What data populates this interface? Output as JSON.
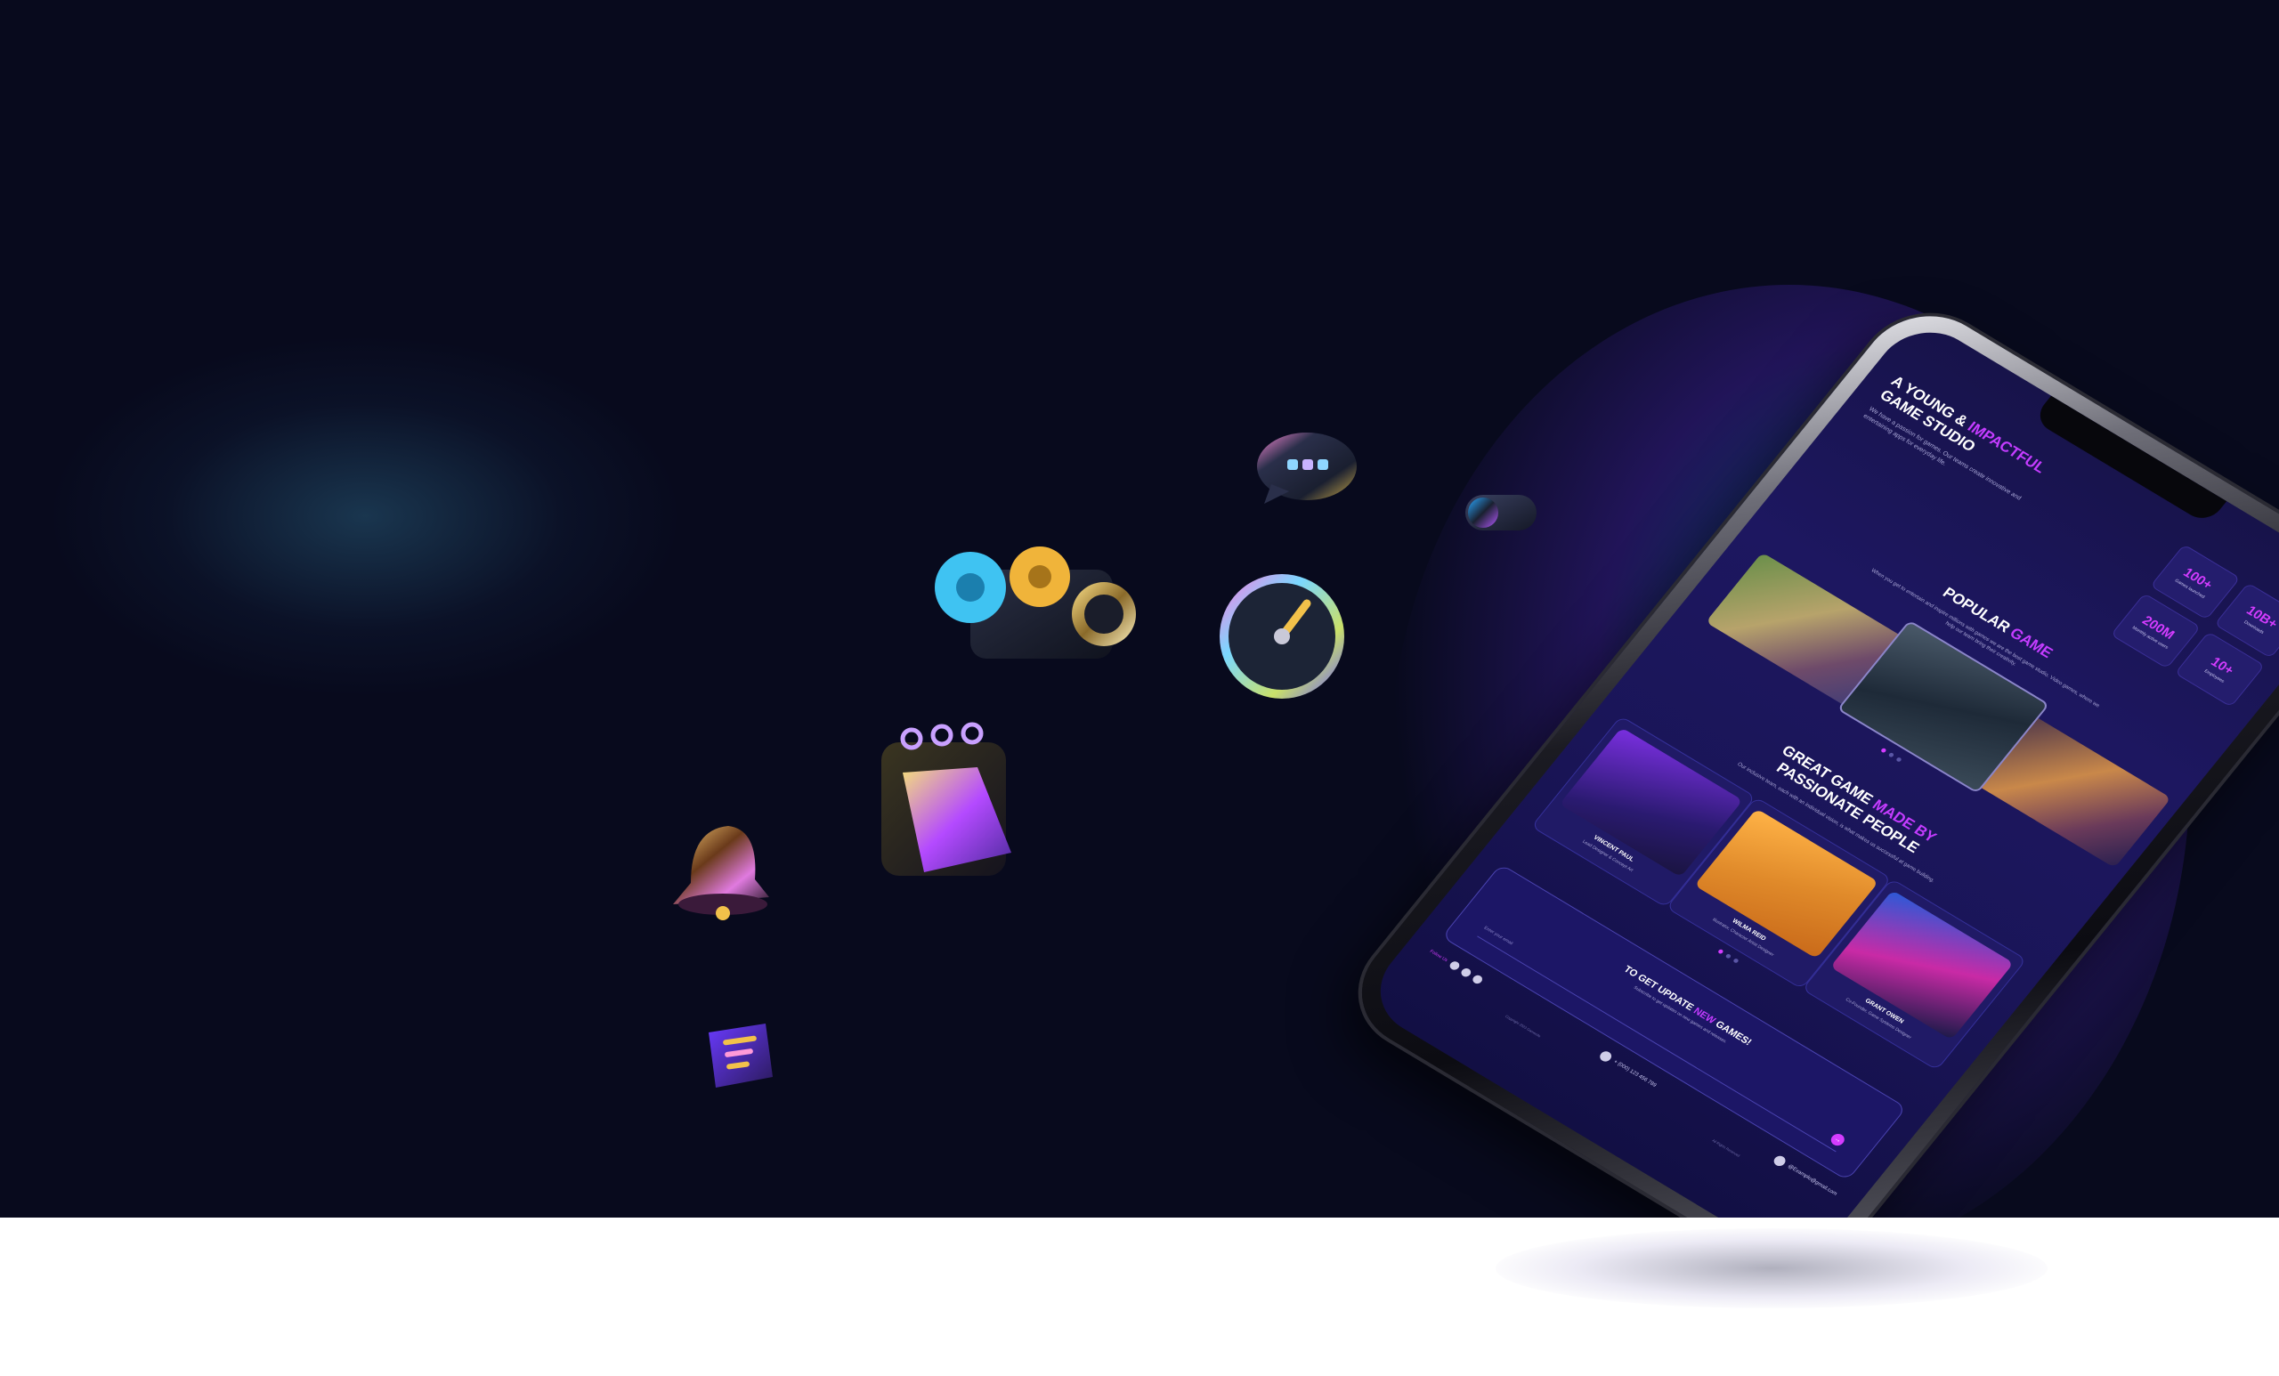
{
  "colors": {
    "background": "#080a1d",
    "accent": "#d43cff",
    "screen": "#1d1760",
    "floor": "#ffffff"
  },
  "floating_icons": [
    "chat-bubble-icon",
    "toggle-switch-icon",
    "camera-icon",
    "gauge-icon",
    "calendar-icon",
    "bell-icon",
    "notes-icon"
  ],
  "phone": {
    "hero": {
      "title_prefix": "A Young &",
      "title_accent": "Impactful",
      "title_suffix": "Game Studio",
      "subtitle": "We have a passion for games. Our teams create innovative and entertaining apps for everyday life."
    },
    "stats": [
      {
        "value": "100+",
        "label": "Games launched"
      },
      {
        "value": "10B+",
        "label": "Downloads"
      },
      {
        "value": "200M",
        "label": "Monthly active users"
      },
      {
        "value": "10+",
        "label": "Employees"
      }
    ],
    "popular": {
      "title_prefix": "Popular",
      "title_accent": "Game",
      "subtitle": "When you get to entertain and inspire millions with games we are the best game studio. Video games, where we help our team bring their creativity."
    },
    "team_section": {
      "title_prefix": "Great Game",
      "title_accent": "Made By",
      "title_suffix": "Passionate People",
      "subtitle": "Our inclusive team, each with an individual vision, is what makes us successful at game building."
    },
    "team": [
      {
        "name": "Vincent Paul",
        "role": "Lead Designer & Concept Art"
      },
      {
        "name": "Wilma Reid",
        "role": "Illustrator, Character Artist Designer"
      },
      {
        "name": "Grant Owen",
        "role": "Co-Founder, Game Systems Designer"
      }
    ],
    "newsletter": {
      "title_prefix": "To Get Update",
      "title_accent": "New",
      "title_suffix": "Games!",
      "subtitle": "Subscribe to get updates on new games and releases.",
      "placeholder": "Enter your email",
      "submit": "→"
    },
    "footer": {
      "follow_label": "Follow Us",
      "phone": "+ (000) 123 456 789",
      "email": "@Example@gmail.com",
      "copyright": "Copyright 2023 Gamesite",
      "rights": "All Rights Reserved"
    }
  }
}
